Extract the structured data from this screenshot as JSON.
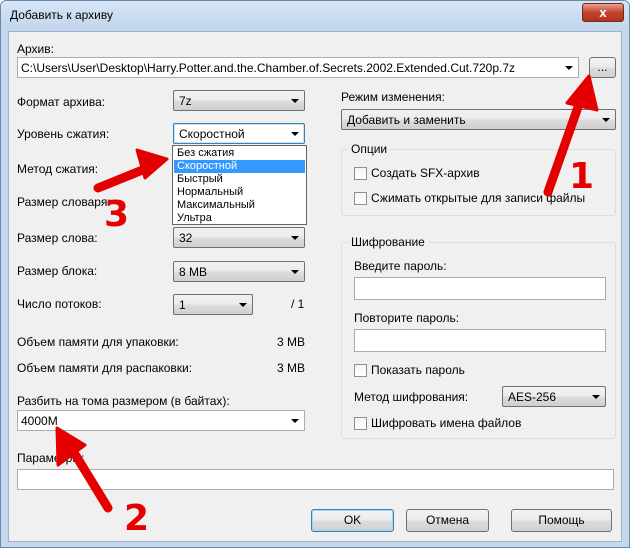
{
  "window": {
    "title": "Добавить к архиву",
    "close_glyph": "x"
  },
  "archive": {
    "label": "Архив:",
    "path": "C:\\Users\\User\\Desktop\\Harry.Potter.and.the.Chamber.of.Secrets.2002.Extended.Cut.720p.7z",
    "browse_label": "..."
  },
  "left": {
    "format_label": "Формат архива:",
    "format_value": "7z",
    "level_label": "Уровень сжатия:",
    "level_value": "Скоростной",
    "method_label": "Метод сжатия:",
    "dict_label": "Размер словаря:",
    "word_label": "Размер слова:",
    "word_value": "32",
    "block_label": "Размер блока:",
    "block_value": "8 MB",
    "threads_label": "Число потоков:",
    "threads_value": "1",
    "threads_total": "/ 1",
    "mem_pack_label": "Объем памяти для упаковки:",
    "mem_pack_value": "3 MB",
    "mem_unpack_label": "Объем памяти для распаковки:",
    "mem_unpack_value": "3 MB",
    "split_label": "Разбить на тома размером (в байтах):",
    "split_value": "4000M",
    "params_label": "Параметры:"
  },
  "level_options": [
    {
      "label": "Без сжатия",
      "selected": false
    },
    {
      "label": "Скоростной",
      "selected": true
    },
    {
      "label": "Быстрый",
      "selected": false
    },
    {
      "label": "Нормальный",
      "selected": false
    },
    {
      "label": "Максимальный",
      "selected": false
    },
    {
      "label": "Ультра",
      "selected": false
    }
  ],
  "right": {
    "update_mode_label": "Режим изменения:",
    "update_mode_value": "Добавить и заменить",
    "options_title": "Опции",
    "sfx_label": "Создать SFX-архив",
    "compress_shared_label": "Сжимать открытые для записи файлы",
    "encryption_title": "Шифрование",
    "enter_password_label": "Введите пароль:",
    "repeat_password_label": "Повторите пароль:",
    "show_password_label": "Показать пароль",
    "enc_method_label": "Метод шифрования:",
    "enc_method_value": "AES-256",
    "encrypt_names_label": "Шифровать имена файлов"
  },
  "buttons": {
    "ok": "OK",
    "cancel": "Отмена",
    "help": "Помощь"
  },
  "annotations": {
    "one": "1",
    "two": "2",
    "three": "3",
    "color": "#e40000"
  }
}
